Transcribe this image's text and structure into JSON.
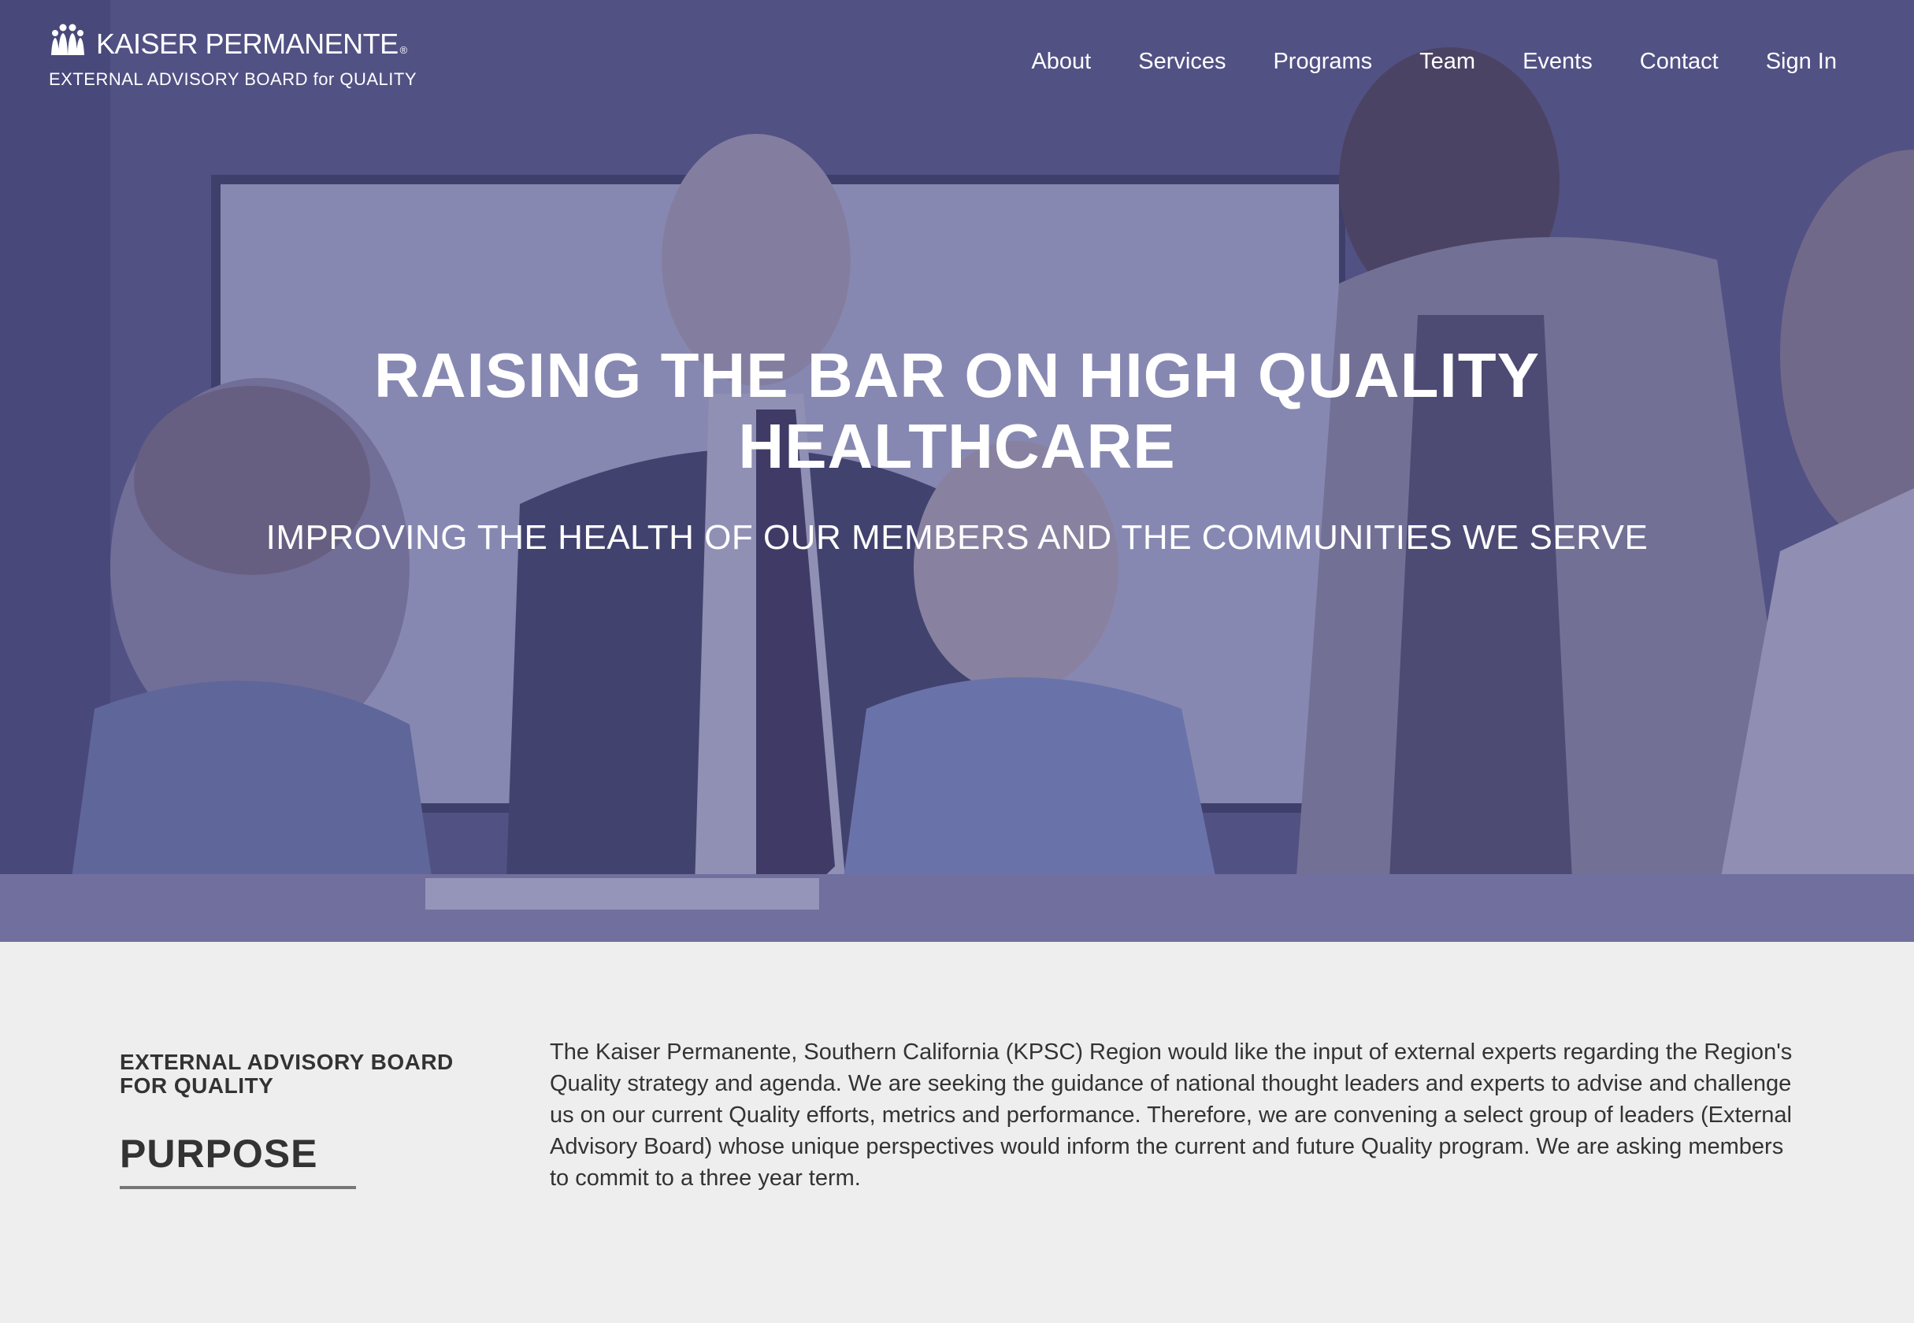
{
  "header": {
    "logo_text": "KAISER PERMANENTE",
    "logo_registered": "®",
    "logo_subtitle": "EXTERNAL ADVISORY BOARD for QUALITY"
  },
  "nav": {
    "items": [
      {
        "label": "About"
      },
      {
        "label": "Services"
      },
      {
        "label": "Programs"
      },
      {
        "label": "Team"
      },
      {
        "label": "Events"
      },
      {
        "label": "Contact"
      },
      {
        "label": "Sign In"
      }
    ]
  },
  "hero": {
    "title_line1": "RAISING THE BAR ON HIGH QUALITY",
    "title_line2": "HEALTHCARE",
    "subtitle": "IMPROVING THE HEALTH OF OUR MEMBERS AND THE COMMUNITIES WE SERVE"
  },
  "purpose": {
    "eyebrow_line1": "EXTERNAL ADVISORY BOARD",
    "eyebrow_line2": "FOR QUALITY",
    "title": "PURPOSE",
    "body": "The Kaiser Permanente, Southern California (KPSC) Region would like the input of external experts regarding the Region's Quality strategy and agenda. We are seeking the guidance of national thought leaders and experts to advise and challenge us on our current Quality efforts, metrics and performance. Therefore, we are convening a select group of leaders (External Advisory Board) whose unique perspectives would inform the current and future Quality program. We are asking members to commit to a three year term."
  },
  "colors": {
    "hero_tint": "#5b5a8c",
    "content_bg": "#eeeeee",
    "text_dark": "#333333",
    "rule": "#777777"
  }
}
